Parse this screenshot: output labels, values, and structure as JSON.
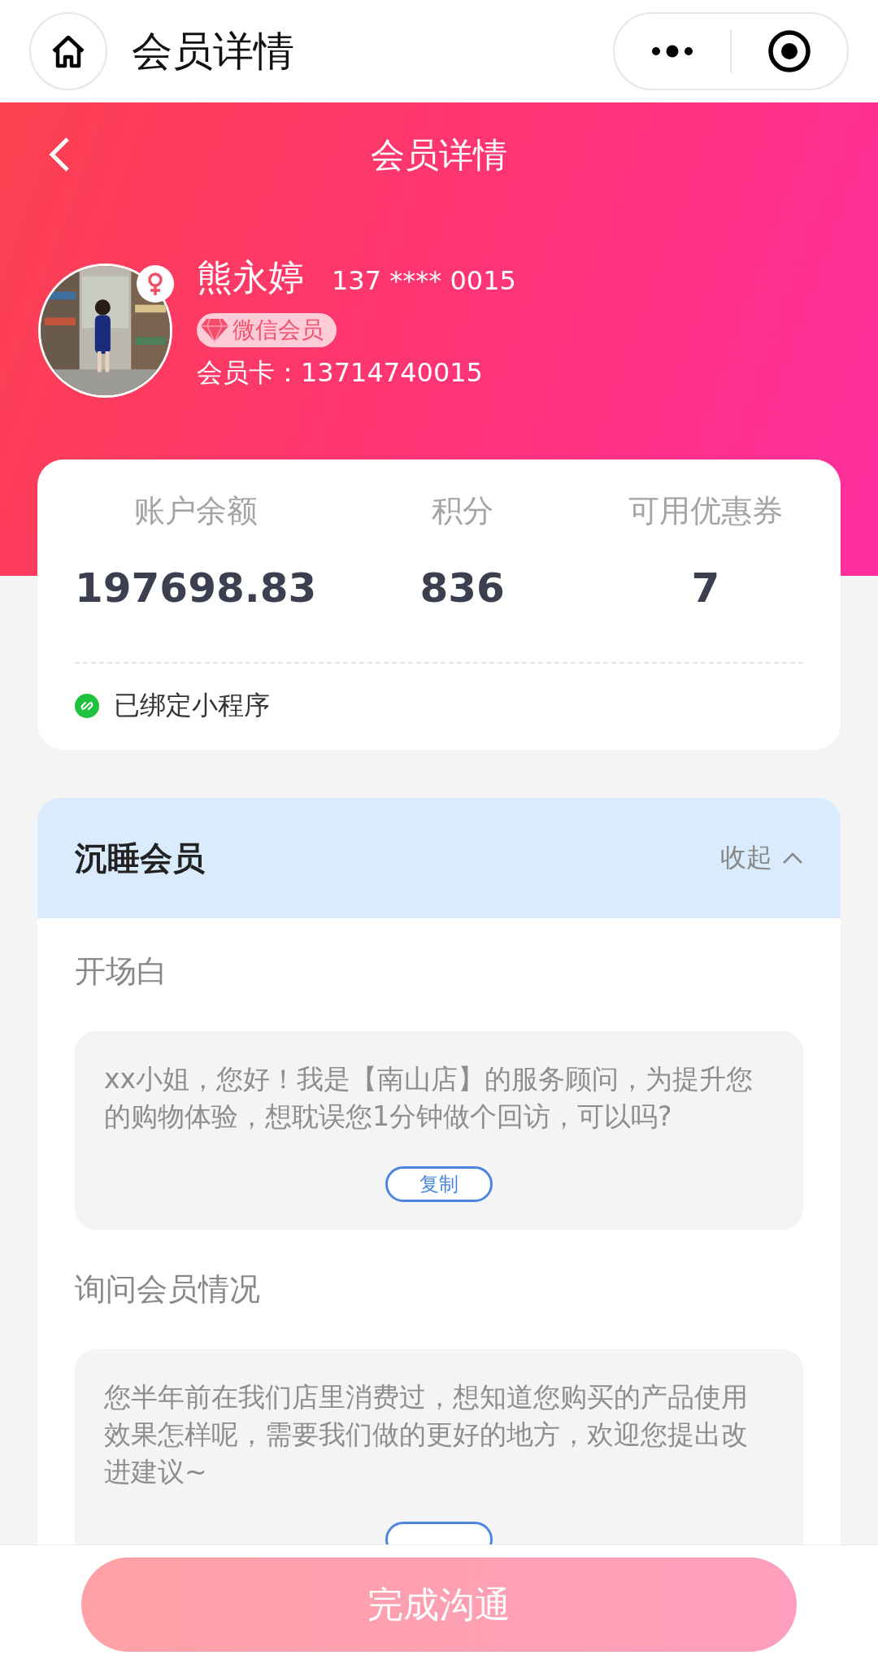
{
  "nav_bar": {
    "title": "会员详情"
  },
  "header": {
    "title": "会员详情"
  },
  "member": {
    "name": "熊永婷",
    "phone": "137 **** 0015",
    "badge": "微信会员",
    "card": "会员卡：13714740015",
    "female": true
  },
  "stats": [
    {
      "label": "账户余额",
      "value": "197698.83"
    },
    {
      "label": "积分",
      "value": "836"
    },
    {
      "label": "可用优惠券",
      "value": "7"
    }
  ],
  "binding": "已绑定小程序",
  "section": {
    "title": "沉睡会员",
    "toggle": "收起",
    "expanded": true,
    "scripts": [
      {
        "heading": "开场白",
        "text": "xx小姐，您好！我是【南山店】的服务顾问，为提升您的购物体验，想耽误您1分钟做个回访，可以吗?",
        "button": "复制"
      },
      {
        "heading": "询问会员情况",
        "text": "您半年前在我们店里消费过，想知道您购买的产品使用效果怎样呢，需要我们做的更好的地方，欢迎您提出改进建议~"
      }
    ]
  },
  "footer_button": "完成沟通"
}
